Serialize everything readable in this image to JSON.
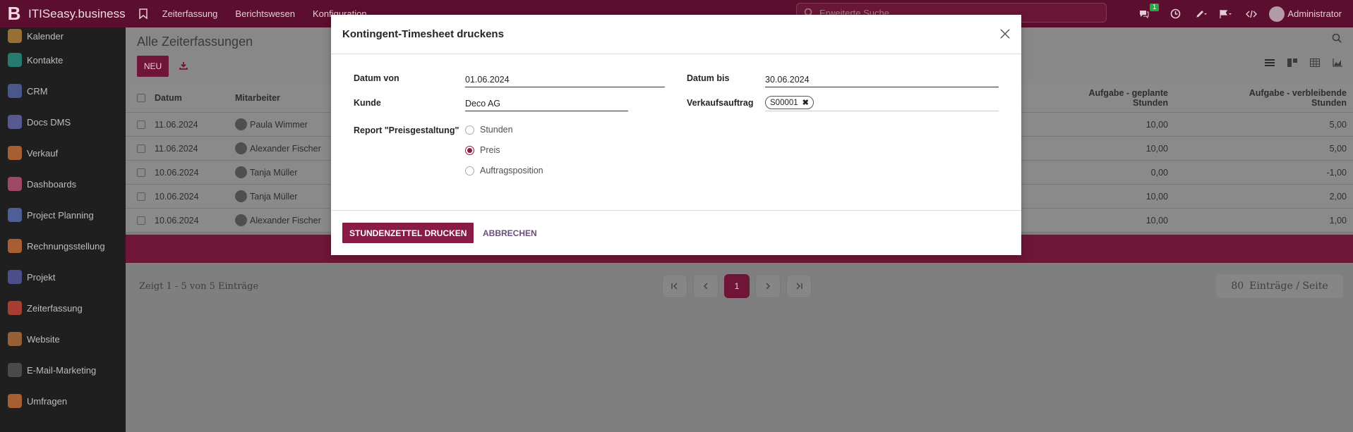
{
  "topbar": {
    "brand_logo": "B",
    "brand_name": "ITISeasy.business",
    "menu": [
      "Zeiterfassung",
      "Berichtswesen",
      "Konfiguration"
    ],
    "search_placeholder": "Erweiterte Suche...",
    "messages_count": "1",
    "user_name": "Administrator"
  },
  "sidebar": {
    "items": [
      {
        "label": "Kalender",
        "icon": "calendar-icon",
        "color": "#c08a3e"
      },
      {
        "label": "Kontakte",
        "icon": "contacts-icon",
        "color": "#2a9b8e"
      },
      {
        "label": "CRM",
        "icon": "crm-icon",
        "color": "#5a6bb0"
      },
      {
        "label": "Docs DMS",
        "icon": "docs-icon",
        "color": "#6b6fb8"
      },
      {
        "label": "Verkauf",
        "icon": "sales-icon",
        "color": "#d5743a"
      },
      {
        "label": "Dashboards",
        "icon": "dashboard-icon",
        "color": "#c9577e"
      },
      {
        "label": "Project Planning",
        "icon": "planning-icon",
        "color": "#5f74c0"
      },
      {
        "label": "Rechnungsstellung",
        "icon": "invoice-icon",
        "color": "#d5743a"
      },
      {
        "label": "Projekt",
        "icon": "project-icon",
        "color": "#5f5fb0"
      },
      {
        "label": "Zeiterfassung",
        "icon": "timer-icon",
        "color": "#d54a3a"
      },
      {
        "label": "Website",
        "icon": "website-icon",
        "color": "#c0763e"
      },
      {
        "label": "E-Mail-Marketing",
        "icon": "email-marketing-icon",
        "color": "#5a5a5a"
      },
      {
        "label": "Umfragen",
        "icon": "survey-icon",
        "color": "#d5743a"
      }
    ]
  },
  "main": {
    "title": "Alle Zeiterfassungen",
    "new_button": "NEU",
    "columns": {
      "date": "Datum",
      "employee": "Mitarbeiter",
      "planned": "Aufgabe - geplante Stunden",
      "remaining": "Aufgabe - verbleibende Stunden"
    },
    "rows": [
      {
        "date": "11.06.2024",
        "employee": "Paula Wimmer",
        "planned": "10,00",
        "remaining": "5,00"
      },
      {
        "date": "11.06.2024",
        "employee": "Alexander Fischer",
        "planned": "10,00",
        "remaining": "5,00"
      },
      {
        "date": "10.06.2024",
        "employee": "Tanja Müller",
        "planned": "0,00",
        "remaining": "-1,00"
      },
      {
        "date": "10.06.2024",
        "employee": "Tanja Müller",
        "planned": "10,00",
        "remaining": "2,00"
      },
      {
        "date": "10.06.2024",
        "employee": "Alexander Fischer",
        "planned": "10,00",
        "remaining": "1,00"
      }
    ],
    "pager": {
      "info": "Zeigt 1 - 5 von 5 Einträge",
      "current_page": "1",
      "per_page_value": "80",
      "per_page_label": "Einträge / Seite"
    }
  },
  "modal": {
    "title": "Kontingent-Timesheet druckens",
    "date_from_label": "Datum von",
    "date_from_value": "01.06.2024",
    "date_to_label": "Datum bis",
    "date_to_value": "30.06.2024",
    "customer_label": "Kunde",
    "customer_value": "Deco AG",
    "sales_order_label": "Verkaufsauftrag",
    "sales_order_tag": "S00001",
    "report_label": "Report \"Preisgestaltung\"",
    "options": [
      {
        "label": "Stunden",
        "selected": false
      },
      {
        "label": "Preis",
        "selected": true
      },
      {
        "label": "Auftragsposition",
        "selected": false
      }
    ],
    "print_button": "STUNDENZETTEL DRUCKEN",
    "cancel_button": "ABBRECHEN"
  }
}
